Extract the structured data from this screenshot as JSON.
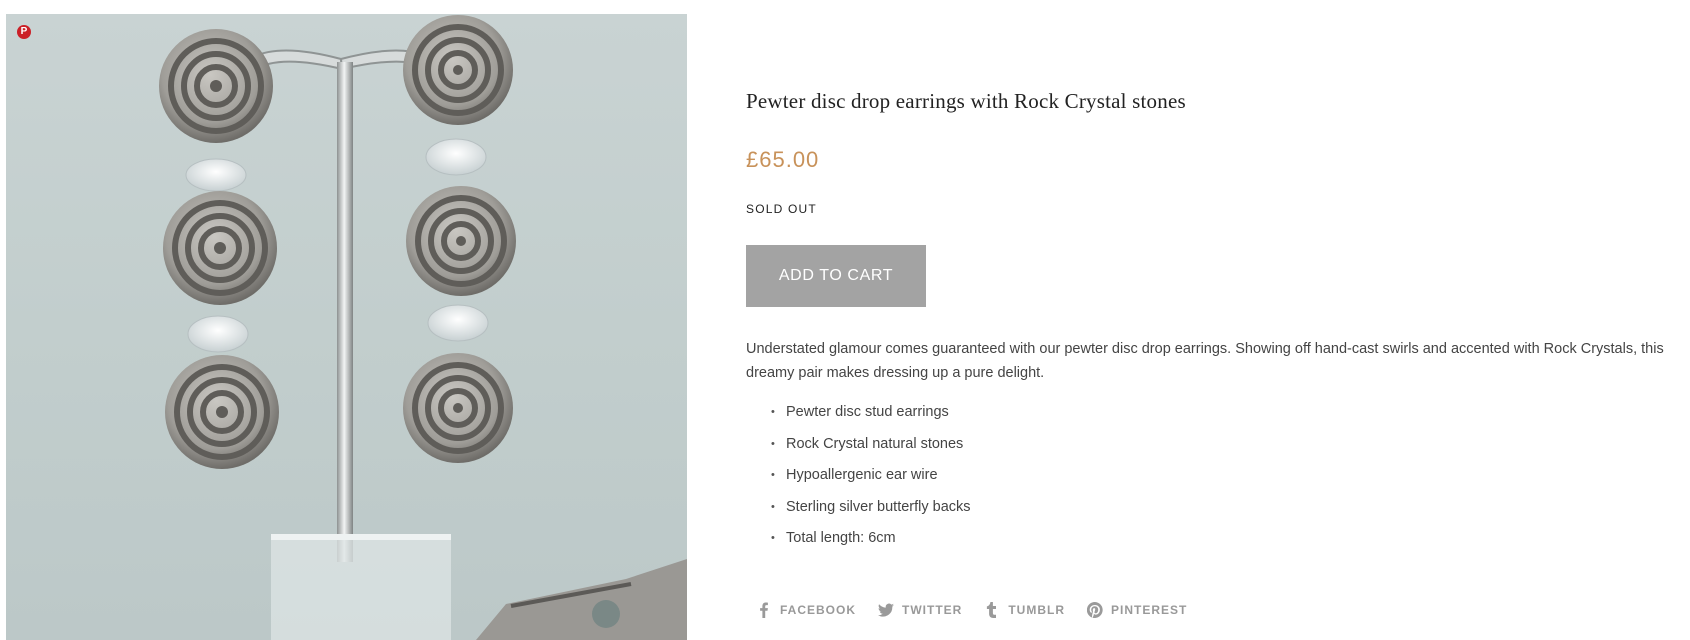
{
  "pin_button": {
    "icon": "pinterest-icon",
    "glyph": "P",
    "color": "#cb2027"
  },
  "product": {
    "title": "Pewter disc drop earrings with Rock Crystal stones",
    "price": "£65.00",
    "stock_status": "SOLD OUT",
    "add_to_cart_label": "ADD TO CART",
    "description": "Understated glamour comes guaranteed with our pewter disc drop earrings. Showing off hand-cast swirls and accented with Rock Crystals, this dreamy pair makes dressing up a pure delight.",
    "features": [
      {
        "text": "Pewter disc stud earrings"
      },
      {
        "text": "Rock Crystal natural stones"
      },
      {
        "text": "Hypoallergenic ear wire"
      },
      {
        "text": "Sterling silver butterfly backs"
      },
      {
        "text": "Total length: 6cm"
      }
    ]
  },
  "share": [
    {
      "label": "FACEBOOK",
      "icon": "facebook-icon"
    },
    {
      "label": "TWITTER",
      "icon": "twitter-icon"
    },
    {
      "label": "TUMBLR",
      "icon": "tumblr-icon"
    },
    {
      "label": "PINTEREST",
      "icon": "pinterest-icon"
    }
  ],
  "colors": {
    "price": "#c8925a",
    "button": "#a3a3a3",
    "share_text": "#999999"
  }
}
